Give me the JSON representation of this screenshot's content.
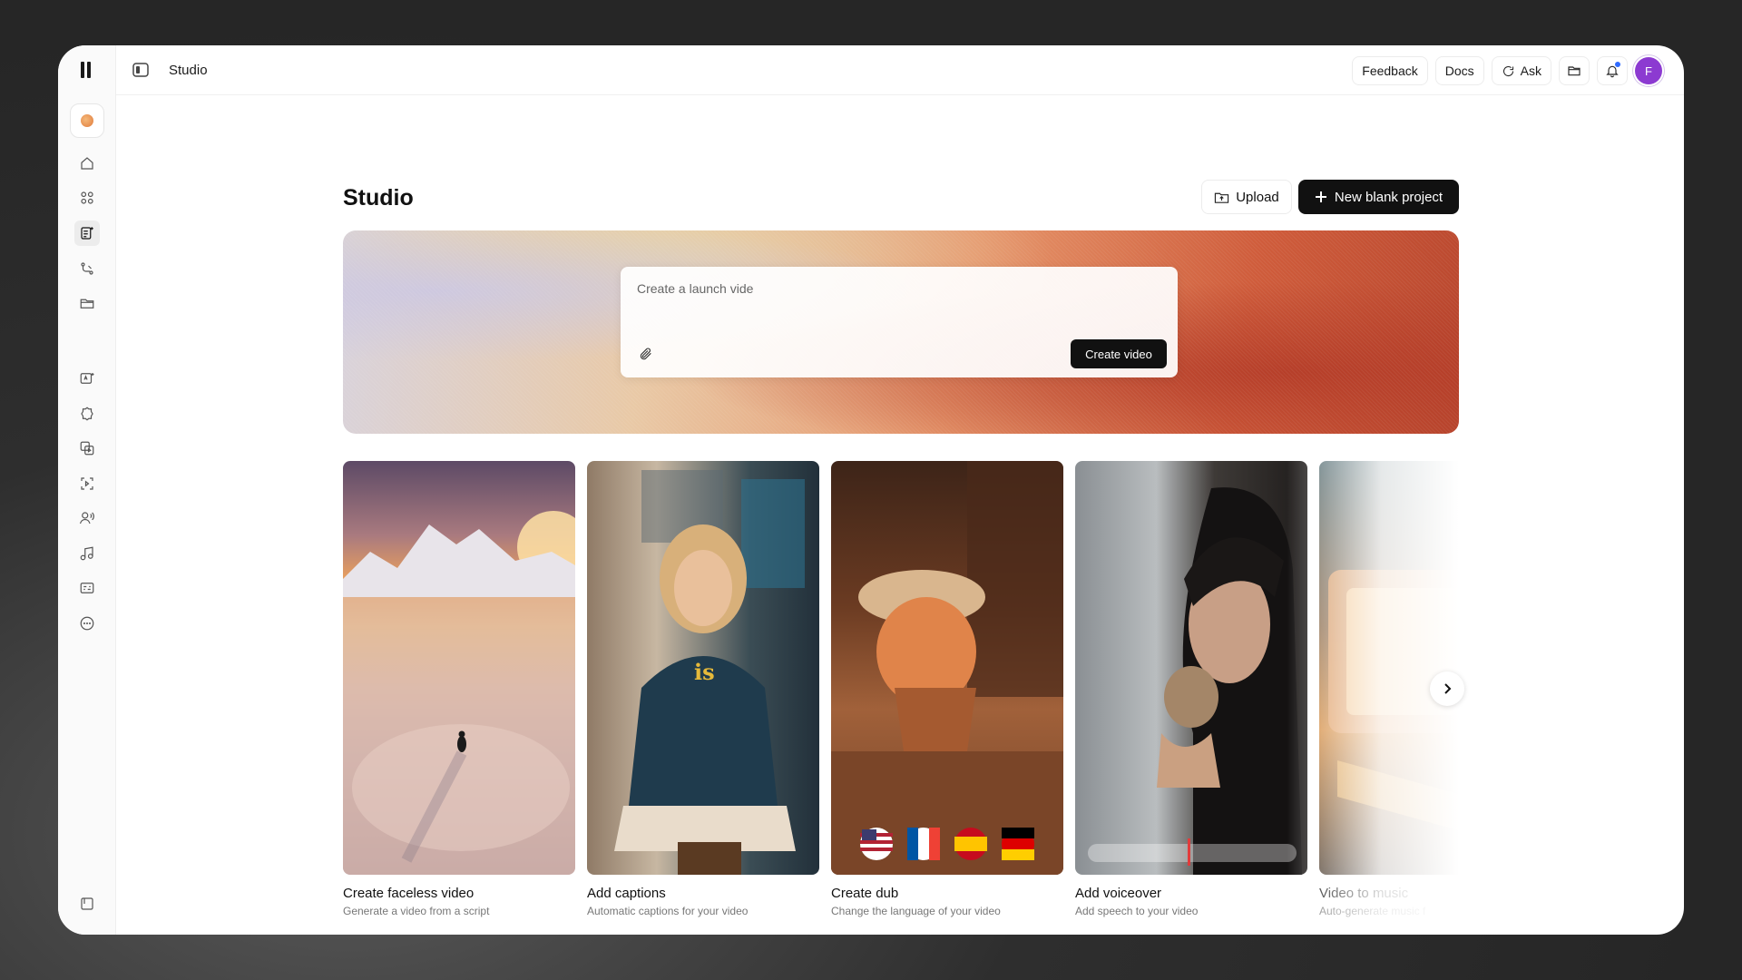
{
  "window": {
    "title": "Studio"
  },
  "topbar": {
    "title": "Studio",
    "feedback_label": "Feedback",
    "docs_label": "Docs",
    "ask_label": "Ask",
    "avatar_initial": "F"
  },
  "sidebar": {
    "icons": [
      "home-icon",
      "grid-icon",
      "studio-icon",
      "flow-icon",
      "folder-icon",
      "text-to-image-icon",
      "badge-icon",
      "media-copy-icon",
      "scan-icon",
      "voice-icon",
      "music-icon",
      "captions-icon",
      "more-icon",
      "panel-icon"
    ],
    "active": "studio-icon"
  },
  "main": {
    "title": "Studio",
    "upload_label": "Upload",
    "new_project_label": "New blank project",
    "prompt": {
      "placeholder": "Create a launch vide",
      "submit_label": "Create video"
    },
    "cards": [
      {
        "title": "Create faceless video",
        "subtitle": "Generate a video from a script"
      },
      {
        "title": "Add captions",
        "subtitle": "Automatic captions for your video",
        "overlay": "is"
      },
      {
        "title": "Create dub",
        "subtitle": "Change the language of your video"
      },
      {
        "title": "Add voiceover",
        "subtitle": "Add speech to your video"
      },
      {
        "title": "Video to music",
        "subtitle": "Auto-generate music f"
      }
    ]
  },
  "colors": {
    "primary_button": "#111111",
    "avatar": "#8c3ad1",
    "notification_dot": "#2f6bff"
  }
}
